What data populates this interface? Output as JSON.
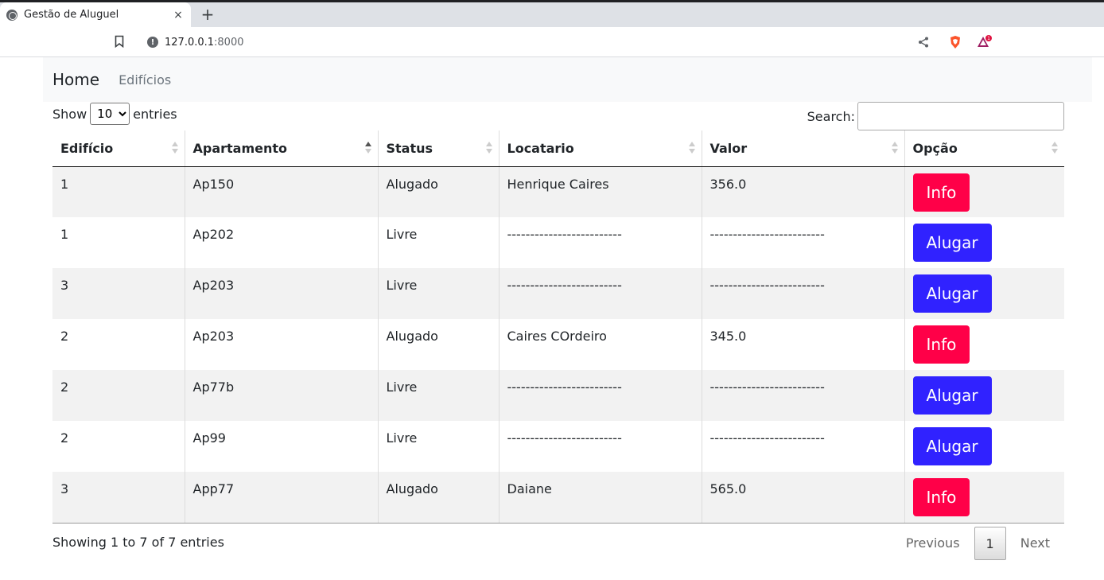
{
  "browser": {
    "tab_title": "Gestão de Aluguel",
    "tab_close": "×",
    "new_tab": "+",
    "url_host": "127.0.0.1",
    "url_port": ":8000",
    "rewards_badge": "1"
  },
  "navbar": {
    "brand": "Home",
    "link": "Edifícios"
  },
  "controls": {
    "show_label": "Show",
    "entries_label": "entries",
    "length_value": "10",
    "search_label": "Search:"
  },
  "table": {
    "headers": [
      "Edifício",
      "Apartamento",
      "Status",
      "Locatario",
      "Valor",
      "Opção"
    ],
    "rows": [
      {
        "edificio": "1",
        "apartamento": "Ap150",
        "status": "Alugado",
        "locatario": "Henrique Caires",
        "valor": "356.0",
        "opcao": "Info"
      },
      {
        "edificio": "1",
        "apartamento": "Ap202",
        "status": "Livre",
        "locatario": "-------------------------",
        "valor": "-------------------------",
        "opcao": "Alugar"
      },
      {
        "edificio": "3",
        "apartamento": "Ap203",
        "status": "Livre",
        "locatario": "-------------------------",
        "valor": "-------------------------",
        "opcao": "Alugar"
      },
      {
        "edificio": "2",
        "apartamento": "Ap203",
        "status": "Alugado",
        "locatario": "Caires COrdeiro",
        "valor": "345.0",
        "opcao": "Info"
      },
      {
        "edificio": "2",
        "apartamento": "Ap77b",
        "status": "Livre",
        "locatario": "-------------------------",
        "valor": "-------------------------",
        "opcao": "Alugar"
      },
      {
        "edificio": "2",
        "apartamento": "Ap99",
        "status": "Livre",
        "locatario": "-------------------------",
        "valor": "-------------------------",
        "opcao": "Alugar"
      },
      {
        "edificio": "3",
        "apartamento": "App77",
        "status": "Alugado",
        "locatario": "Daiane",
        "valor": "565.0",
        "opcao": "Info"
      }
    ]
  },
  "footer": {
    "info": "Showing 1 to 7 of 7 entries",
    "previous": "Previous",
    "page": "1",
    "next": "Next"
  },
  "colors": {
    "info_button": "#ff0048",
    "rent_button": "#3022ff"
  }
}
